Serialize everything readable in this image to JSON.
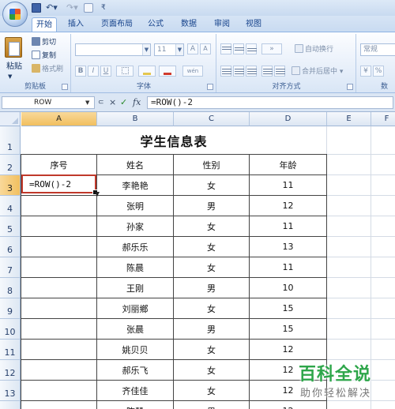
{
  "quick_access": {
    "custom_symbol": "₹"
  },
  "tabs": [
    {
      "label": "开始",
      "active": true
    },
    {
      "label": "插入",
      "active": false
    },
    {
      "label": "页面布局",
      "active": false
    },
    {
      "label": "公式",
      "active": false
    },
    {
      "label": "数据",
      "active": false
    },
    {
      "label": "审阅",
      "active": false
    },
    {
      "label": "视图",
      "active": false
    }
  ],
  "ribbon": {
    "clipboard": {
      "label": "剪贴板",
      "paste": "粘贴",
      "cut": "剪切",
      "copy": "复制",
      "format_painter": "格式刷"
    },
    "font": {
      "label": "字体",
      "font_name": "",
      "font_size": "11",
      "grow": "A",
      "shrink": "A",
      "bold": "B",
      "italic": "I",
      "underline": "U",
      "phonetic": "wén"
    },
    "alignment": {
      "label": "对齐方式",
      "wrap_text": "自动换行",
      "merge_center": "合并后居中"
    },
    "number": {
      "format": "常规",
      "label": "数"
    }
  },
  "formula_bar": {
    "name_box": "ROW",
    "cancel_symbol": "×",
    "enter_symbol": "✓",
    "fx_symbol": "fx",
    "formula": "=ROW()-2"
  },
  "sheet": {
    "columns": [
      "A",
      "B",
      "C",
      "D",
      "E",
      "F"
    ],
    "rows": [
      "1",
      "2",
      "3",
      "4",
      "5",
      "6",
      "7",
      "8",
      "9",
      "10",
      "11",
      "12",
      "13",
      "14"
    ],
    "selected_column": "A",
    "selected_row": "3",
    "title": "学生信息表",
    "headers": [
      "序号",
      "姓名",
      "性别",
      "年龄"
    ],
    "editing_cell": "=ROW()-2",
    "records": [
      {
        "name": "李艳艳",
        "gender": "女",
        "age": "11"
      },
      {
        "name": "张明",
        "gender": "男",
        "age": "12"
      },
      {
        "name": "孙家",
        "gender": "女",
        "age": "11"
      },
      {
        "name": "郝乐乐",
        "gender": "女",
        "age": "13"
      },
      {
        "name": "陈晨",
        "gender": "女",
        "age": "11"
      },
      {
        "name": "王刚",
        "gender": "男",
        "age": "10"
      },
      {
        "name": "刘丽鄉",
        "gender": "女",
        "age": "15"
      },
      {
        "name": "张晨",
        "gender": "男",
        "age": "15"
      },
      {
        "name": "姚贝贝",
        "gender": "女",
        "age": "12"
      },
      {
        "name": "郝乐飞",
        "gender": "女",
        "age": "12"
      },
      {
        "name": "齐佳佳",
        "gender": "女",
        "age": "12"
      },
      {
        "name": "陈慧",
        "gender": "男",
        "age": "12"
      }
    ]
  },
  "watermark": {
    "main": "百科全说",
    "sub": "助你轻松解决"
  }
}
